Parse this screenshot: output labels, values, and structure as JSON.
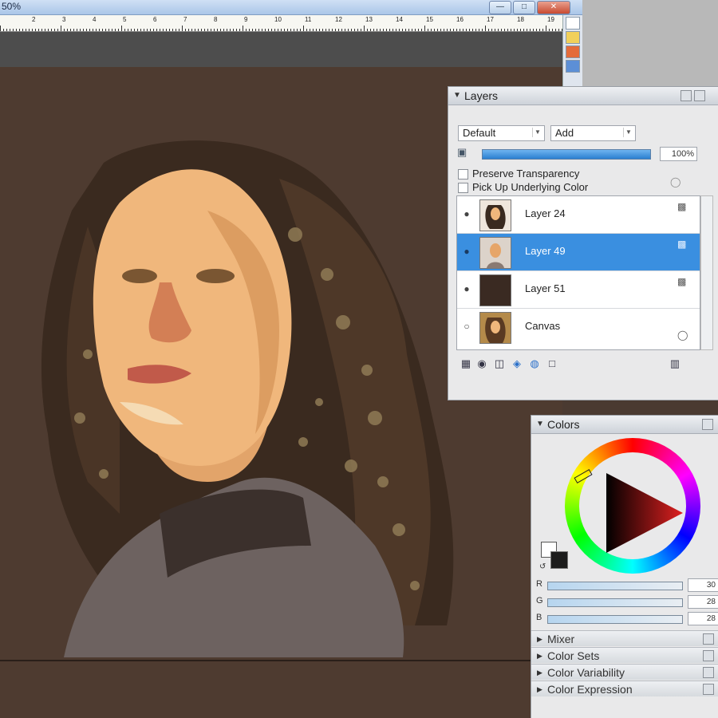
{
  "window": {
    "zoom": "50%"
  },
  "ruler": {
    "numbers": [
      "2",
      "3",
      "4",
      "5",
      "6",
      "7",
      "8",
      "9",
      "10",
      "11",
      "12",
      "13",
      "14",
      "15",
      "16",
      "17",
      "18",
      "19"
    ]
  },
  "layers": {
    "title": "Layers",
    "composite_method": "Default",
    "composite_depth": "Add",
    "opacity": "100%",
    "preserve_transparency": "Preserve Transparency",
    "pick_up_underlying": "Pick Up Underlying Color",
    "items": [
      {
        "name": "Layer 24",
        "selected": false
      },
      {
        "name": "Layer 49",
        "selected": true
      },
      {
        "name": "Layer 51",
        "selected": false
      },
      {
        "name": "Canvas",
        "selected": false
      }
    ]
  },
  "colors": {
    "title": "Colors",
    "r_label": "R",
    "r_value": "30",
    "g_label": "G",
    "g_value": "28",
    "b_label": "B",
    "b_value": "28",
    "foreground": "#1c1c1c",
    "background": "#ffffff",
    "subpanels": [
      "Mixer",
      "Color Sets",
      "Color Variability",
      "Color Expression"
    ]
  }
}
